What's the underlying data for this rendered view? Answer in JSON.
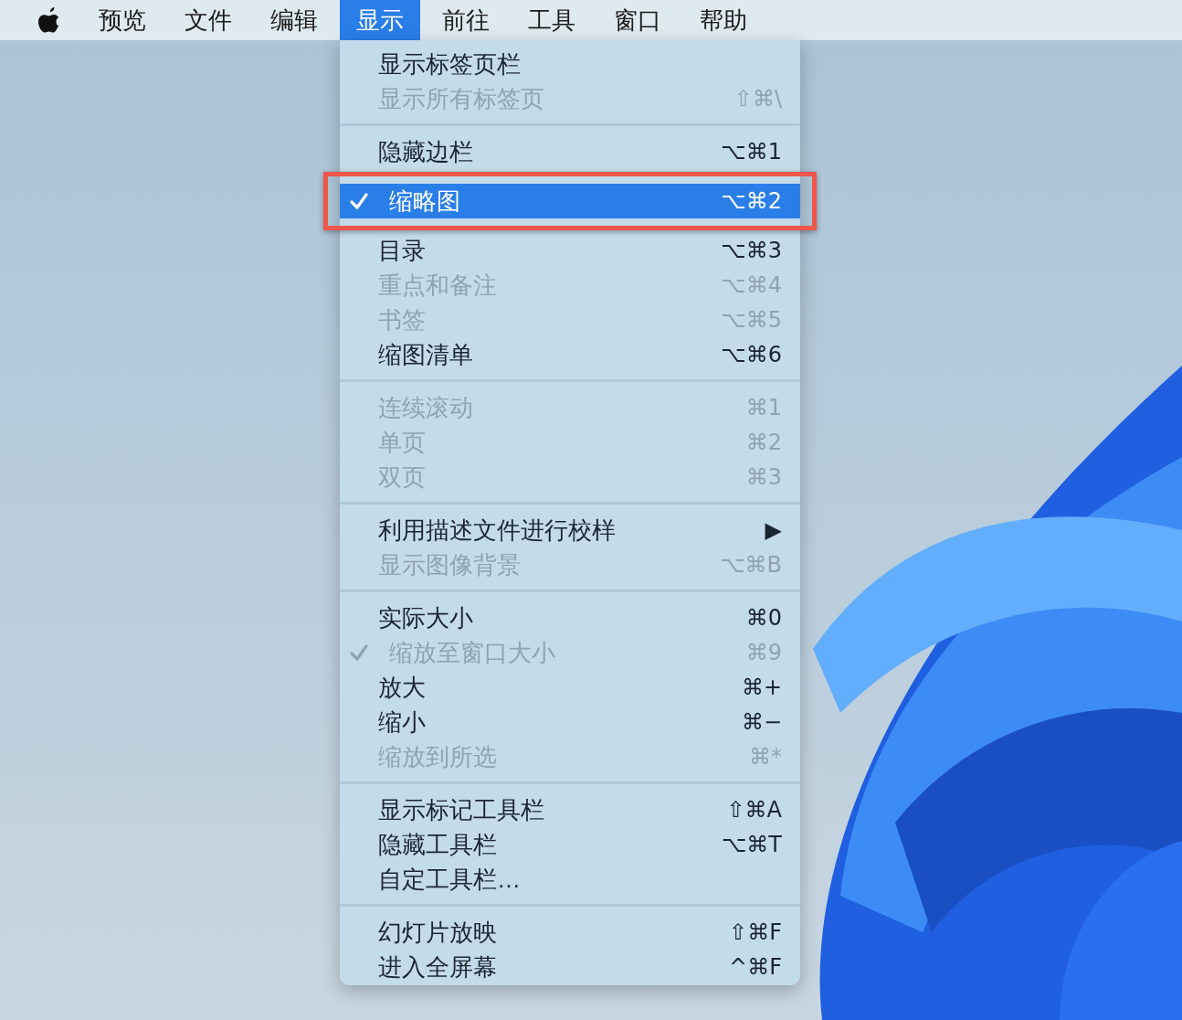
{
  "menubar": {
    "items": [
      {
        "label": "预览",
        "selected": false
      },
      {
        "label": "文件",
        "selected": false
      },
      {
        "label": "编辑",
        "selected": false
      },
      {
        "label": "显示",
        "selected": true
      },
      {
        "label": "前往",
        "selected": false
      },
      {
        "label": "工具",
        "selected": false
      },
      {
        "label": "窗口",
        "selected": false
      },
      {
        "label": "帮助",
        "selected": false
      }
    ]
  },
  "menu": {
    "sections": [
      {
        "items": [
          {
            "label": "显示标签页栏",
            "disabled": false,
            "checked": false,
            "selected": false
          },
          {
            "label": "显示所有标签页",
            "shortcut": "⇧⌘\\",
            "disabled": true,
            "checked": false,
            "selected": false
          }
        ]
      },
      {
        "items": [
          {
            "label": "隐藏边栏",
            "shortcut": "⌥⌘1",
            "disabled": false,
            "checked": false,
            "selected": false
          },
          {
            "label": "缩略图",
            "shortcut": "⌥⌘2",
            "disabled": false,
            "checked": true,
            "selected": true
          },
          {
            "label": "目录",
            "shortcut": "⌥⌘3",
            "disabled": false,
            "checked": false,
            "selected": false
          },
          {
            "label": "重点和备注",
            "shortcut": "⌥⌘4",
            "disabled": true,
            "checked": false,
            "selected": false
          },
          {
            "label": "书签",
            "shortcut": "⌥⌘5",
            "disabled": true,
            "checked": false,
            "selected": false
          },
          {
            "label": "缩图清单",
            "shortcut": "⌥⌘6",
            "disabled": false,
            "checked": false,
            "selected": false
          }
        ]
      },
      {
        "items": [
          {
            "label": "连续滚动",
            "shortcut": "⌘1",
            "disabled": true,
            "checked": false,
            "selected": false
          },
          {
            "label": "单页",
            "shortcut": "⌘2",
            "disabled": true,
            "checked": false,
            "selected": false
          },
          {
            "label": "双页",
            "shortcut": "⌘3",
            "disabled": true,
            "checked": false,
            "selected": false
          }
        ]
      },
      {
        "items": [
          {
            "label": "利用描述文件进行校样",
            "shortcut": "▶",
            "disabled": false,
            "checked": false,
            "selected": false
          },
          {
            "label": "显示图像背景",
            "shortcut": "⌥⌘B",
            "disabled": true,
            "checked": false,
            "selected": false
          }
        ]
      },
      {
        "items": [
          {
            "label": "实际大小",
            "shortcut": "⌘0",
            "disabled": false,
            "checked": false,
            "selected": false
          },
          {
            "label": "缩放至窗口大小",
            "shortcut": "⌘9",
            "disabled": true,
            "checked": true,
            "selected": false
          },
          {
            "label": "放大",
            "shortcut": "⌘+",
            "disabled": false,
            "checked": false,
            "selected": false
          },
          {
            "label": "缩小",
            "shortcut": "⌘−",
            "disabled": false,
            "checked": false,
            "selected": false
          },
          {
            "label": "缩放到所选",
            "shortcut": "⌘*",
            "disabled": true,
            "checked": false,
            "selected": false
          }
        ]
      },
      {
        "items": [
          {
            "label": "显示标记工具栏",
            "shortcut": "⇧⌘A",
            "disabled": false,
            "checked": false,
            "selected": false
          },
          {
            "label": "隐藏工具栏",
            "shortcut": "⌥⌘T",
            "disabled": false,
            "checked": false,
            "selected": false
          },
          {
            "label": "自定工具栏…",
            "disabled": false,
            "checked": false,
            "selected": false
          }
        ]
      },
      {
        "items": [
          {
            "label": "幻灯片放映",
            "shortcut": "⇧⌘F",
            "disabled": false,
            "checked": false,
            "selected": false
          },
          {
            "label": "进入全屏幕",
            "shortcut": "^⌘F",
            "disabled": false,
            "checked": false,
            "selected": false
          }
        ]
      }
    ]
  }
}
